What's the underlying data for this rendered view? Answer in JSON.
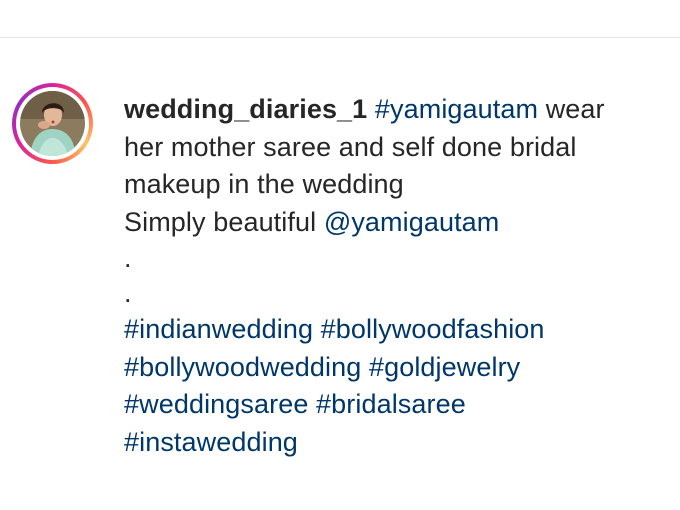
{
  "post": {
    "username": "wedding_diaries_1",
    "caption": {
      "line1_tag": "#yamigautam",
      "line1_rest": "wear",
      "line2": "her mother saree and self done bridal",
      "line3": "makeup in the wedding",
      "line4_text": "Simply beautiful",
      "line4_mention": "@yamigautam",
      "dot1": ".",
      "dot2": ".",
      "hashtags": [
        "#indianwedding",
        "#bollywoodfashion",
        "#bollywoodwedding",
        "#goldjewelry",
        "#weddingsaree",
        "#bridalsaree",
        "#instawedding"
      ]
    }
  },
  "colors": {
    "text": "#262626",
    "link": "#00376b",
    "divider": "#e6e6e6",
    "story_ring": [
      "#d6249f",
      "#fd5949",
      "#fdc468",
      "#962fbf"
    ]
  },
  "icons": {
    "avatar": "profile-photo"
  }
}
